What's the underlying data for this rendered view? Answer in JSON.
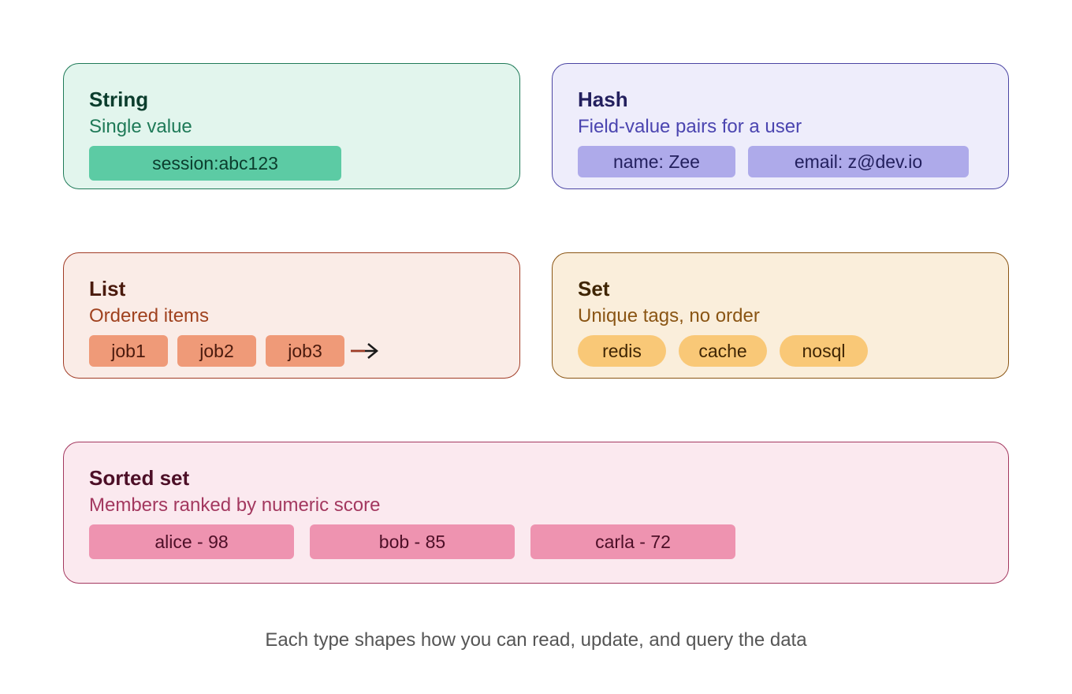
{
  "cards": {
    "string": {
      "title": "String",
      "subtitle": "Single value",
      "items": [
        "session:abc123"
      ]
    },
    "hash": {
      "title": "Hash",
      "subtitle": "Field-value pairs for a user",
      "items": [
        "name: Zee",
        "email: z@dev.io"
      ]
    },
    "list": {
      "title": "List",
      "subtitle": "Ordered items",
      "items": [
        "job1",
        "job2",
        "job3"
      ],
      "arrow_icon": "arrow-right-icon"
    },
    "set": {
      "title": "Set",
      "subtitle": "Unique tags, no order",
      "items": [
        "redis",
        "cache",
        "nosql"
      ]
    },
    "sorted_set": {
      "title": "Sorted set",
      "subtitle": "Members ranked by numeric score",
      "items": [
        "alice - 98",
        "bob - 85",
        "carla - 72"
      ]
    }
  },
  "footer": {
    "caption": "Each type shapes how you can read, update, and query the data"
  },
  "colors": {
    "string": "#5ccba4",
    "hash": "#aeaaea",
    "list": "#ef9a78",
    "set": "#f9c877",
    "sorted_set": "#ee93b0"
  }
}
